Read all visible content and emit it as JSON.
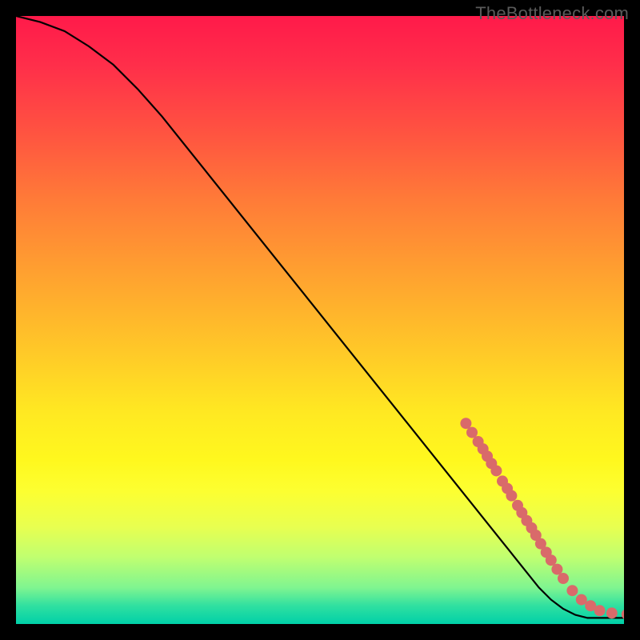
{
  "watermark": "TheBottleneck.com",
  "chart_data": {
    "type": "line",
    "title": "",
    "xlabel": "",
    "ylabel": "",
    "xlim": [
      0,
      100
    ],
    "ylim": [
      0,
      100
    ],
    "series": [
      {
        "name": "curve",
        "x": [
          0,
          4,
          8,
          12,
          16,
          20,
          24,
          28,
          32,
          36,
          40,
          44,
          48,
          52,
          56,
          60,
          64,
          68,
          72,
          74,
          76,
          78,
          80,
          82,
          84,
          86,
          88,
          90,
          92,
          94,
          96,
          98,
          100
        ],
        "y": [
          100,
          99,
          97.5,
          95,
          92,
          88,
          83.5,
          78.5,
          73.5,
          68.5,
          63.5,
          58.5,
          53.5,
          48.5,
          43.5,
          38.5,
          33.5,
          28.5,
          23.5,
          21,
          18.5,
          16,
          13.5,
          11,
          8.5,
          6,
          4,
          2.5,
          1.5,
          1,
          1,
          1,
          1
        ]
      }
    ],
    "markers": {
      "name": "dots",
      "color": "#d96a6a",
      "radius": 7,
      "points": [
        {
          "x": 74,
          "y": 33
        },
        {
          "x": 75,
          "y": 31.5
        },
        {
          "x": 76,
          "y": 30
        },
        {
          "x": 76.8,
          "y": 28.8
        },
        {
          "x": 77.5,
          "y": 27.6
        },
        {
          "x": 78.2,
          "y": 26.4
        },
        {
          "x": 79,
          "y": 25.2
        },
        {
          "x": 80,
          "y": 23.5
        },
        {
          "x": 80.8,
          "y": 22.3
        },
        {
          "x": 81.5,
          "y": 21.1
        },
        {
          "x": 82.5,
          "y": 19.5
        },
        {
          "x": 83.2,
          "y": 18.3
        },
        {
          "x": 84,
          "y": 17
        },
        {
          "x": 84.8,
          "y": 15.8
        },
        {
          "x": 85.5,
          "y": 14.6
        },
        {
          "x": 86.3,
          "y": 13.2
        },
        {
          "x": 87.2,
          "y": 11.8
        },
        {
          "x": 88,
          "y": 10.5
        },
        {
          "x": 89,
          "y": 9
        },
        {
          "x": 90,
          "y": 7.5
        },
        {
          "x": 91.5,
          "y": 5.5
        },
        {
          "x": 93,
          "y": 4
        },
        {
          "x": 94.5,
          "y": 3
        },
        {
          "x": 96,
          "y": 2.2
        },
        {
          "x": 98,
          "y": 1.8
        },
        {
          "x": 100.5,
          "y": 1.6
        },
        {
          "x": 101.5,
          "y": 1.6
        }
      ]
    }
  }
}
